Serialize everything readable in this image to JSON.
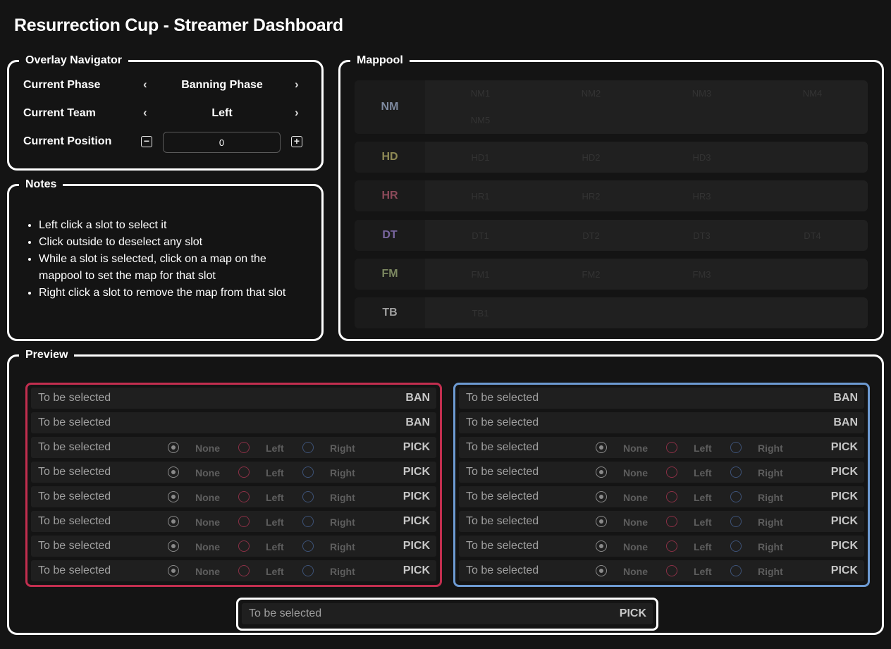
{
  "page": {
    "title": "Resurrection Cup - Streamer Dashboard"
  },
  "overlay_navigator": {
    "legend": "Overlay Navigator",
    "phase": {
      "label": "Current Phase",
      "value": "Banning Phase",
      "prev_icon": "‹",
      "next_icon": "›"
    },
    "team": {
      "label": "Current Team",
      "value": "Left",
      "prev_icon": "‹",
      "next_icon": "›"
    },
    "position": {
      "label": "Current Position",
      "value": "0",
      "minus_icon": "−",
      "plus_icon": "+"
    }
  },
  "notes": {
    "legend": "Notes",
    "items": [
      "Left click a slot to select it",
      "Click outside to deselect any slot",
      "While a slot is selected, click on a map on the mappool to set the map for that slot",
      "Right click a slot to remove the map from that slot"
    ]
  },
  "mappool": {
    "legend": "Mappool",
    "rows": [
      {
        "mod": "NM",
        "color": "#7e8aa0",
        "maps": [
          "NM1",
          "NM2",
          "NM3",
          "NM4",
          "NM5"
        ]
      },
      {
        "mod": "HD",
        "color": "#8f8a55",
        "maps": [
          "HD1",
          "HD2",
          "HD3"
        ]
      },
      {
        "mod": "HR",
        "color": "#8c4a5a",
        "maps": [
          "HR1",
          "HR2",
          "HR3"
        ]
      },
      {
        "mod": "DT",
        "color": "#7a67a0",
        "maps": [
          "DT1",
          "DT2",
          "DT3",
          "DT4"
        ]
      },
      {
        "mod": "FM",
        "color": "#7b8760",
        "maps": [
          "FM1",
          "FM2",
          "FM3"
        ]
      },
      {
        "mod": "TB",
        "color": "#a0a0a0",
        "maps": [
          "TB1"
        ]
      }
    ]
  },
  "preview": {
    "legend": "Preview",
    "placeholder": "To be selected",
    "ban_label": "BAN",
    "pick_label": "PICK",
    "radio_labels": {
      "none": "None",
      "left": "Left",
      "right": "Right"
    },
    "left_team_color": "#c22e4f",
    "right_team_color": "#6d9ad2",
    "left_slots": [
      "BAN",
      "BAN",
      "PICK",
      "PICK",
      "PICK",
      "PICK",
      "PICK",
      "PICK"
    ],
    "right_slots": [
      "BAN",
      "BAN",
      "PICK",
      "PICK",
      "PICK",
      "PICK",
      "PICK",
      "PICK"
    ],
    "tiebreaker": {
      "map": "To be selected",
      "kind": "PICK"
    }
  }
}
